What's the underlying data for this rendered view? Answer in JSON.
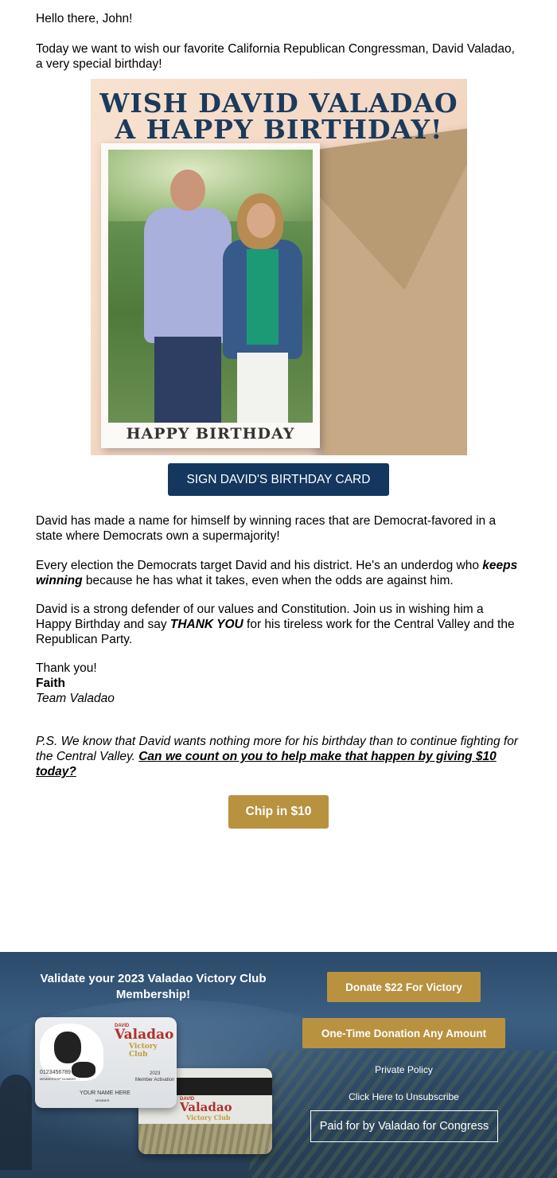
{
  "greeting": "Hello there, John!",
  "intro": "Today we want to wish our favorite California Republican Congressman, David Valadao, a very special birthday!",
  "hero": {
    "title_line1": "WISH DAVID VALADAO",
    "title_line2": "A HAPPY BIRTHDAY!",
    "card_caption": "HAPPY BIRTHDAY"
  },
  "cta_sign": "SIGN DAVID'S BIRTHDAY CARD",
  "body": {
    "p1": "David has made a name for himself by winning races that are Democrat-favored in a state where Democrats own a supermajority!",
    "p2_before": "Every election the Democrats target David and his district. He's an underdog who ",
    "p2_emph": "keeps winning",
    "p2_after": " because he has what it takes, even when the odds are against him.",
    "p3_before": "David is a strong defender of our values and Constitution. Join us in wishing him a Happy Birthday and say ",
    "p3_emph": "THANK YOU",
    "p3_after": " for his tireless work for the Central Valley and the Republican Party."
  },
  "signoff": {
    "thanks": "Thank you!",
    "name": "Faith",
    "team": "Team Valadao"
  },
  "ps": {
    "text": "P.S. We know that David wants nothing more for his birthday than to continue fighting for the Central Valley. ",
    "link": "Can we count on you to help make that happen by giving $10 today?"
  },
  "cta_chip": "Chip in $10",
  "footer": {
    "headline": "Validate your 2023 Valadao Victory Club Membership!",
    "donate_button": "Donate $22 For Victory",
    "one_time_button": "One-Time Donation Any Amount",
    "privacy_link": "Private Policy",
    "unsubscribe_link": "Click Here to Unsubscribe",
    "paid_for": "Paid for by Valadao for Congress",
    "card": {
      "kicker": "DAVID",
      "brand": "Valadao",
      "sub": "Victory Club",
      "number": "0123456789",
      "number_label": "MEMBERSHIP NUMBER",
      "year": "2023",
      "activation": "Member Activation",
      "name": "YOUR NAME HERE",
      "name_label": "MEMBER"
    }
  }
}
